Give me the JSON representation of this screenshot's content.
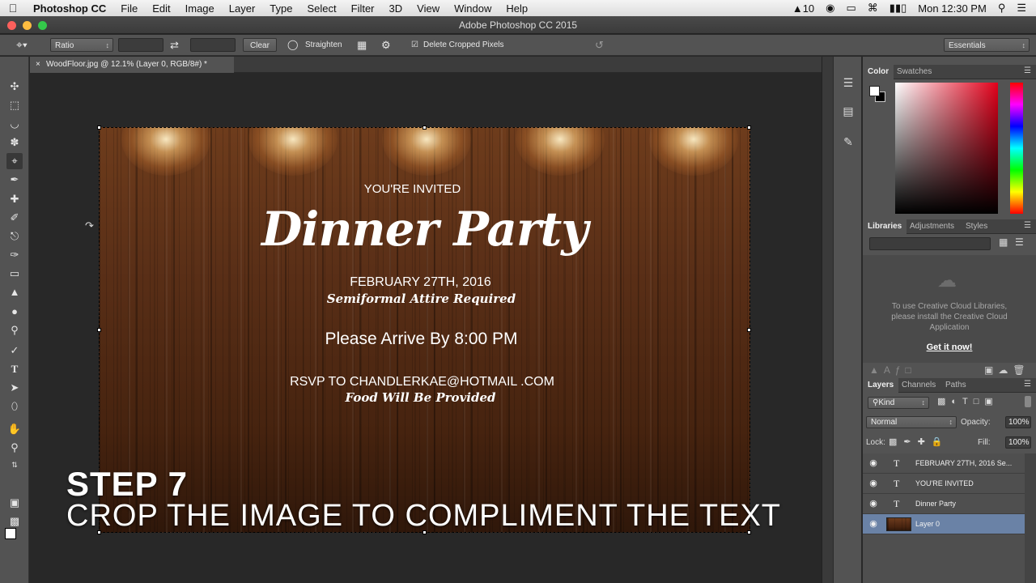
{
  "menubar": {
    "apple": "",
    "app": "Photoshop CC",
    "items": [
      "File",
      "Edit",
      "Image",
      "Layer",
      "Type",
      "Select",
      "Filter",
      "3D",
      "View",
      "Window",
      "Help"
    ],
    "status_text": "10",
    "clock": "Mon 12:30 PM"
  },
  "window": {
    "title": "Adobe Photoshop CC 2015"
  },
  "options": {
    "ratio": "Ratio",
    "clear": "Clear",
    "straighten": "Straighten",
    "delete_cropped": "Delete Cropped Pixels",
    "delete_cropped_checked": true,
    "workspace": "Essentials"
  },
  "document": {
    "tab": "WoodFloor.jpg @ 12.1% (Layer 0, RGB/8#) *"
  },
  "invite": {
    "line1": "YOU'RE INVITED",
    "title": "Dinner Party",
    "date": "FEBRUARY 27TH, 2016",
    "attire": "Semiformal Attire Required",
    "arrive": "Please Arrive By 8:00 PM",
    "rsvp": "RSVP TO CHANDLERKAE@HOTMAIL .COM",
    "food": "Food Will Be Provided"
  },
  "caption": {
    "step": "STEP 7",
    "text": "CROP THE IMAGE TO COMPLIMENT THE TEXT"
  },
  "panels": {
    "color_tabs": [
      "Color",
      "Swatches"
    ],
    "lib_tabs": [
      "Libraries",
      "Adjustments",
      "Styles"
    ],
    "lib_message": "To use Creative Cloud Libraries, please install the Creative Cloud Application",
    "lib_link": "Get it now!",
    "layer_tabs": [
      "Layers",
      "Channels",
      "Paths"
    ],
    "kind": "Kind",
    "blend": "Normal",
    "opacity_label": "Opacity:",
    "opacity": "100%",
    "lock_label": "Lock:",
    "fill_label": "Fill:",
    "fill": "100%",
    "layers": [
      {
        "type": "T",
        "name": "FEBRUARY 27TH, 2016 Se..."
      },
      {
        "type": "T",
        "name": "YOU'RE INVITED"
      },
      {
        "type": "T",
        "name": "Dinner Party"
      },
      {
        "type": "img",
        "name": "Layer 0"
      }
    ]
  },
  "colors": {
    "accent": "#e2001a",
    "selected_layer": "#6a82a6",
    "link": "#ffffff"
  }
}
